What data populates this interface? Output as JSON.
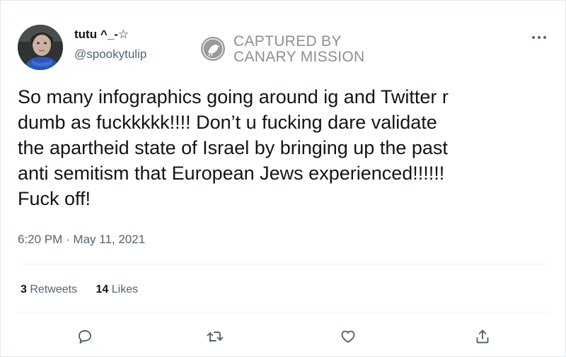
{
  "tweet": {
    "display_name": "tutu ^_-☆",
    "handle": "@spookytulip",
    "text_lines": [
      "So many infographics going around ig and Twitter r",
      "dumb as fuckkkkk!!!!  Don’t u fucking dare validate",
      "the apartheid state of Israel by bringing up the past",
      "anti semitism that European Jews experienced!!!!!!",
      "Fuck off!"
    ],
    "timestamp": "6:20 PM · May 11, 2021",
    "retweets": {
      "count": "3",
      "label": "Retweets"
    },
    "likes": {
      "count": "14",
      "label": "Likes"
    }
  },
  "watermark": {
    "line1": "CAPTURED BY",
    "line2": "CANARY MISSION"
  },
  "icons": {
    "more": "more-icon",
    "reply": "reply-icon",
    "retweet": "retweet-icon",
    "like": "heart-icon",
    "share": "share-icon"
  },
  "colors": {
    "text": "#0f1419",
    "secondary": "#536471",
    "divider": "#eff3f4",
    "watermark": "#8f8f8f"
  }
}
